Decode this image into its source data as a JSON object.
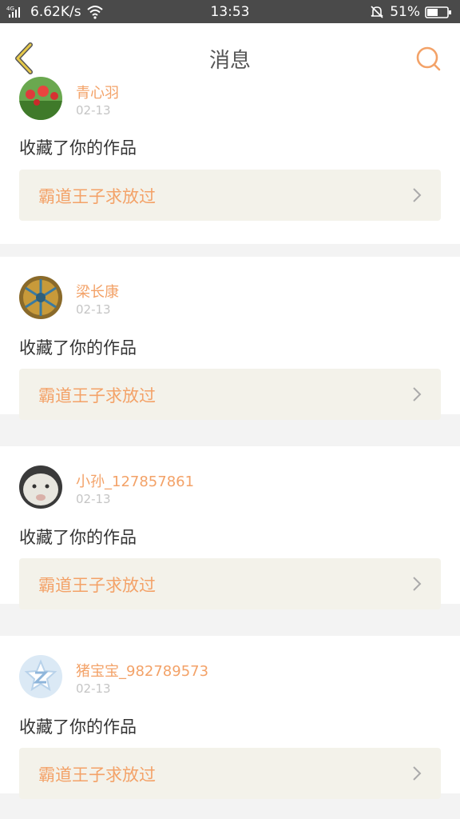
{
  "status_bar": {
    "network_speed": "6.62K/s",
    "time": "13:53",
    "battery": "51%"
  },
  "header": {
    "title": "消息"
  },
  "messages": [
    {
      "user": "青心羽",
      "date": "02-13",
      "text": "收藏了你的作品",
      "work": "霸道王子求放过"
    },
    {
      "user": "梁长康",
      "date": "02-13",
      "text": "收藏了你的作品",
      "work": "霸道王子求放过"
    },
    {
      "user": "小孙_127857861",
      "date": "02-13",
      "text": "收藏了你的作品",
      "work": "霸道王子求放过"
    },
    {
      "user": "猪宝宝_982789573",
      "date": "02-13",
      "text": "收藏了你的作品",
      "work": "霸道王子求放过"
    }
  ],
  "colors": {
    "accent": "#f3a268",
    "status_bar": "#4a4a4a",
    "back_icon": "#e6c94a"
  },
  "icons": [
    "signal-icon",
    "wifi-icon",
    "mute-icon",
    "battery-icon",
    "back-icon",
    "search-icon",
    "chevron-right-icon"
  ]
}
